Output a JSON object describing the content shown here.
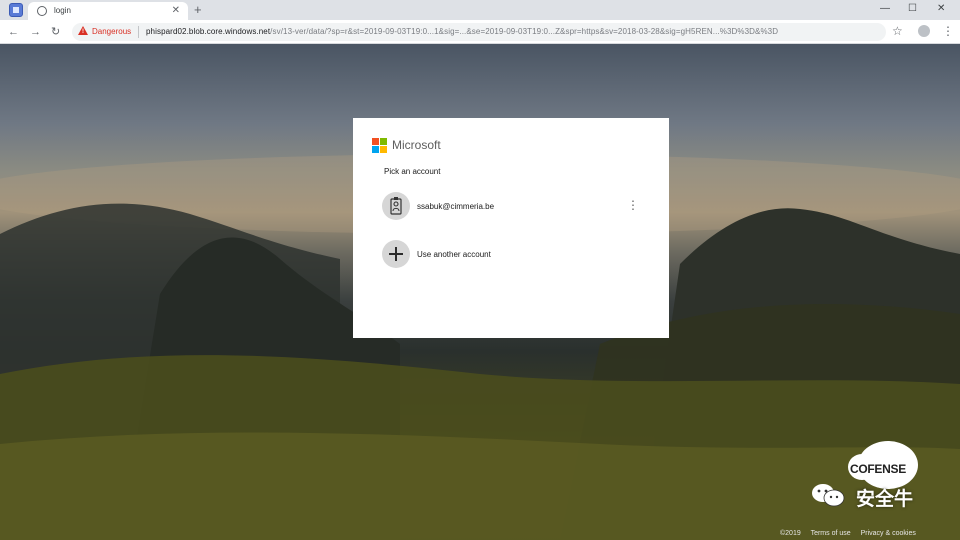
{
  "browser": {
    "tab_title": "login",
    "tab_close": "✕",
    "new_tab": "+",
    "window_controls": [
      "—",
      "☐",
      "✕"
    ],
    "nav": {
      "back": "←",
      "forward": "→",
      "reload": "↻"
    },
    "security_label": "Dangerous",
    "url_host": "phispard02.blob.core.windows.net",
    "url_path": "/sv/13-ver/data/?sp=r&st=2019-09-03T19:0...1&sig=...&se=2019-09-03T19:0...Z&spr=https&sv=2018-03-28&sig=gH5REN...%3D%3D&%3D",
    "star": "☆",
    "menu": "⋮"
  },
  "login": {
    "brand": "Microsoft",
    "brand_colors": [
      "#f25022",
      "#7fba00",
      "#00a4ef",
      "#ffb900"
    ],
    "heading": "Pick an account",
    "account_email": "ssabuk@cimmeria.be",
    "account_menu": "⋮",
    "other_account": "Use another account"
  },
  "footer": {
    "copyright": "©2019",
    "terms": "Terms of use",
    "privacy": "Privacy & cookies"
  },
  "watermark": {
    "cofense": "COFENSE",
    "channel": "安全牛"
  }
}
